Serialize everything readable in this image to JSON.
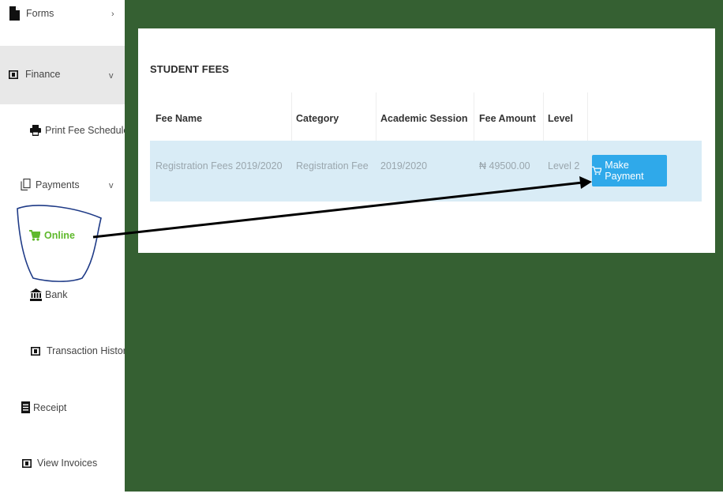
{
  "sidebar": {
    "forms": "Forms",
    "finance": "Finance",
    "print_fee_schedule": "Print Fee Schedule",
    "payments": "Payments",
    "online": "Online",
    "bank": "Bank",
    "transaction_history": "Transaction History",
    "receipt": "Receipt",
    "view_invoices": "View Invoices",
    "forms_chevron": "›",
    "finance_chevron": "v",
    "payments_chevron": "v"
  },
  "card": {
    "title": "STUDENT FEES",
    "headers": [
      "Fee Name",
      "Category",
      "Academic Session",
      "Fee Amount",
      "Level"
    ],
    "row": {
      "fee_name": "Registration Fees 2019/2020",
      "category": "Registration Fee",
      "session": "2019/2020",
      "amount": "₦ 49500.00",
      "level": "Level 2"
    },
    "button_label": "Make Payment"
  },
  "colors": {
    "main_bg": "#356032",
    "button": "#2fa9ea",
    "row_highlight": "#d9ecf6",
    "active_item": "#5fb92c",
    "annotation": "#1f3b87"
  }
}
